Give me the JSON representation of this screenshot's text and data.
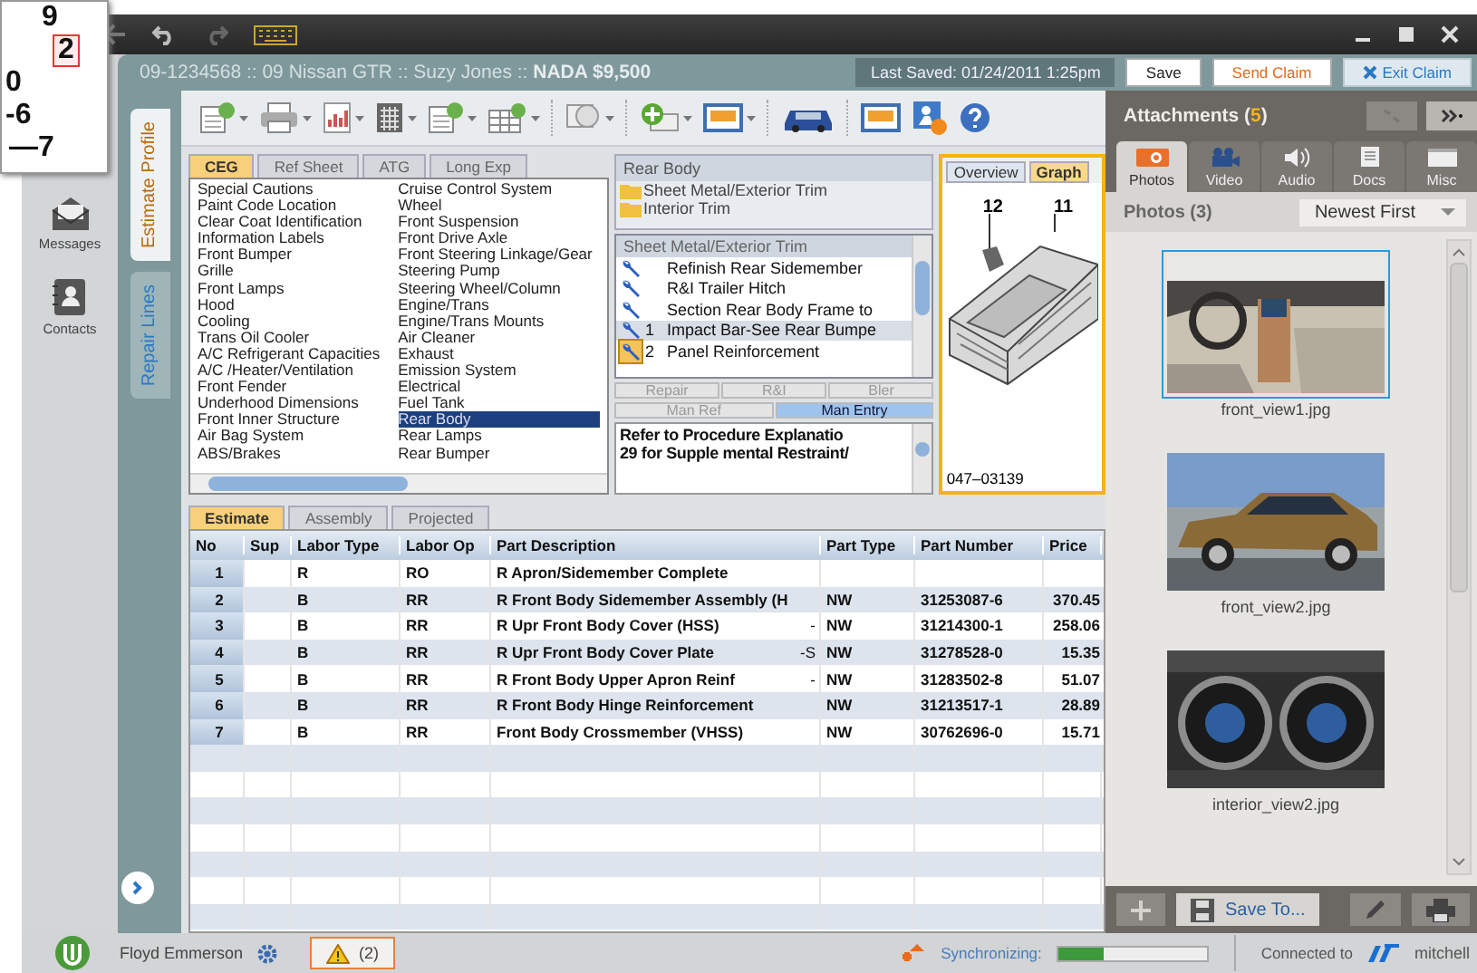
{
  "callout": {
    "lines": [
      {
        "text": "9",
        "highlighted": false
      },
      {
        "text": "2",
        "highlighted": true
      },
      {
        "text": "0",
        "highlighted": false
      },
      {
        "text": "-6",
        "highlighted": false
      },
      {
        "text": "—7",
        "highlighted": false
      }
    ]
  },
  "header": {
    "claim": "09-1234568 :: 09 Nissan GTR :: Suzy Jones ::",
    "nada": "NADA $9,500",
    "last_saved": "Last Saved: 01/24/2011 1:25pm",
    "buttons": [
      {
        "label": "Save",
        "kind": "plain"
      },
      {
        "label": "Send Claim",
        "kind": "accent"
      },
      {
        "label": "Exit Claim",
        "kind": "exit"
      }
    ]
  },
  "sidebar": {
    "items": [
      {
        "label": "Messages",
        "kind": "envelope"
      },
      {
        "label": "Contacts",
        "kind": "contact"
      }
    ]
  },
  "side_tabs": [
    {
      "label": "Estimate Profile",
      "selected": true
    },
    {
      "label": "Repair Lines",
      "selected": false
    }
  ],
  "category_tabs": [
    {
      "label": "CEG",
      "selected": true
    },
    {
      "label": "Ref Sheet",
      "selected": false
    },
    {
      "label": "ATG",
      "selected": false
    },
    {
      "label": "Long Exp",
      "selected": false
    }
  ],
  "categories": {
    "column_1": [
      {
        "label": "Special Cautions",
        "selected": false
      },
      {
        "label": "Paint Code Location",
        "selected": false
      },
      {
        "label": "Clear Coat Identification",
        "selected": false
      },
      {
        "label": "Information Labels",
        "selected": false
      },
      {
        "label": "Front Bumper",
        "selected": false
      },
      {
        "label": "Grille",
        "selected": false
      },
      {
        "label": "Front Lamps",
        "selected": false
      },
      {
        "label": "Hood",
        "selected": false
      },
      {
        "label": "Cooling",
        "selected": false
      },
      {
        "label": "Trans Oil Cooler",
        "selected": false
      },
      {
        "label": "A/C Refrigerant Capacities",
        "selected": false
      },
      {
        "label": "A/C /Heater/Ventilation",
        "selected": false
      },
      {
        "label": "Front Fender",
        "selected": false
      },
      {
        "label": "Underhood Dimensions",
        "selected": false
      },
      {
        "label": "Front Inner Structure",
        "selected": false
      },
      {
        "label": "Air Bag System",
        "selected": false
      },
      {
        "label": "ABS/Brakes",
        "selected": false
      }
    ],
    "column_2": [
      {
        "label": "Cruise Control System",
        "selected": false
      },
      {
        "label": "Wheel",
        "selected": false
      },
      {
        "label": "Front Suspension",
        "selected": false
      },
      {
        "label": "Front Drive Axle",
        "selected": false
      },
      {
        "label": "Front Steering Linkage/Gear",
        "selected": false
      },
      {
        "label": "Steering Pump",
        "selected": false
      },
      {
        "label": "Steering Wheel/Column",
        "selected": false
      },
      {
        "label": "Engine/Trans",
        "selected": false
      },
      {
        "label": "Engine/Trans Mounts",
        "selected": false
      },
      {
        "label": "Air Cleaner",
        "selected": false
      },
      {
        "label": "Exhaust",
        "selected": false
      },
      {
        "label": "Emission System",
        "selected": false
      },
      {
        "label": "Electrical",
        "selected": false
      },
      {
        "label": "Fuel Tank",
        "selected": false
      },
      {
        "label": "Rear Body",
        "selected": true
      },
      {
        "label": "Rear Lamps",
        "selected": false
      },
      {
        "label": "Rear Bumper",
        "selected": false
      }
    ]
  },
  "section": {
    "title": "Rear Body",
    "folders": [
      "Sheet Metal/Exterior Trim",
      "Interior Trim"
    ]
  },
  "operations": {
    "title": "Sheet Metal/Exterior Trim",
    "items": [
      {
        "label": "Refinish Rear Sidemember",
        "selected": false,
        "flagged": false
      },
      {
        "label": "R&I Trailer Hitch",
        "selected": false,
        "flagged": false
      },
      {
        "label": "Section Rear Body Frame to",
        "selected": false,
        "flagged": false
      },
      {
        "number": "1",
        "label": "Impact Bar-See Rear Bumpe",
        "selected": true,
        "flagged": false
      },
      {
        "number": "2",
        "label": "Panel Reinforcement",
        "selected": false,
        "flagged": true
      }
    ]
  },
  "op_buttons": [
    {
      "label": "Repair",
      "disabled": true
    },
    {
      "label": "R&I",
      "disabled": true
    },
    {
      "label": "Bler",
      "disabled": true
    }
  ],
  "ref_buttons": [
    {
      "label": "Man Ref",
      "selected": false
    },
    {
      "label": "Man Entry",
      "selected": true
    }
  ],
  "note": [
    "Refer to Procedure Explanatio",
    "29 for Supple mental Restraint/"
  ],
  "graphic": {
    "tabs": [
      {
        "label": "Overview",
        "selected": false
      },
      {
        "label": "Graph",
        "selected": true
      }
    ],
    "callouts": [
      "12",
      "11"
    ],
    "figure_id": "047–03139"
  },
  "estimate_tabs": [
    {
      "label": "Estimate",
      "selected": true
    },
    {
      "label": "Assembly",
      "selected": false
    },
    {
      "label": "Projected",
      "selected": false
    }
  ],
  "table": {
    "columns": [
      "No",
      "Sup",
      "Labor Type",
      "Labor Op",
      "Part Description",
      "Part Type",
      "Part Number",
      "Price"
    ],
    "rows": [
      {
        "no": "1",
        "sup": "",
        "labor_type": "R",
        "labor_op": "RO",
        "description": "R Apron/Sidemember Complete",
        "flag": "",
        "part_type": "",
        "part_number": "",
        "price": ""
      },
      {
        "no": "2",
        "sup": "",
        "labor_type": "B",
        "labor_op": "RR",
        "description": "R Front Body Sidemember Assembly (H",
        "flag": "",
        "part_type": "NW",
        "part_number": "31253087-6",
        "price": "370.45"
      },
      {
        "no": "3",
        "sup": "",
        "labor_type": "B",
        "labor_op": "RR",
        "description": "R Upr Front Body Cover (HSS)",
        "flag": "-",
        "part_type": "NW",
        "part_number": "31214300-1",
        "price": "258.06"
      },
      {
        "no": "4",
        "sup": "",
        "labor_type": "B",
        "labor_op": "RR",
        "description": "R Upr Front Body Cover Plate",
        "flag": "-S",
        "part_type": "NW",
        "part_number": "31278528-0",
        "price": "15.35"
      },
      {
        "no": "5",
        "sup": "",
        "labor_type": "B",
        "labor_op": "RR",
        "description": "R Front Body Upper Apron Reinf",
        "flag": "-",
        "part_type": "NW",
        "part_number": "31283502-8",
        "price": "51.07"
      },
      {
        "no": "6",
        "sup": "",
        "labor_type": "B",
        "labor_op": "RR",
        "description": "R Front Body Hinge Reinforcement",
        "flag": "",
        "part_type": "NW",
        "part_number": "31213517-1",
        "price": "28.89"
      },
      {
        "no": "7",
        "sup": "",
        "labor_type": "B",
        "labor_op": "RR",
        "description": "Front Body Crossmember (VHSS)",
        "flag": "",
        "part_type": "NW",
        "part_number": "30762696-0",
        "price": "15.71"
      }
    ]
  },
  "attachments": {
    "title": "Attachments (",
    "count": "5",
    "title_end": ")",
    "tabs": [
      {
        "label": "Photos",
        "kind": "camera",
        "selected": true
      },
      {
        "label": "Video",
        "kind": "video",
        "selected": false
      },
      {
        "label": "Audio",
        "kind": "audio",
        "selected": false
      },
      {
        "label": "Docs",
        "kind": "doc",
        "selected": false
      },
      {
        "label": "Misc",
        "kind": "misc",
        "selected": false
      }
    ],
    "filter_label": "Photos (3)",
    "sort": "Newest First",
    "photos": [
      {
        "file": "front_view1.jpg",
        "selected": true
      },
      {
        "file": "front_view2.jpg",
        "selected": false
      },
      {
        "file": "interior_view2.jpg",
        "selected": false
      }
    ],
    "save_button": "Save To..."
  },
  "status_bar": {
    "user": "Floyd Emmerson",
    "warnings": "(2)",
    "sync_label": "Synchronizing:",
    "sync": {
      "level": 0.3
    },
    "connected": "Connected to",
    "brand": "mitchell"
  }
}
